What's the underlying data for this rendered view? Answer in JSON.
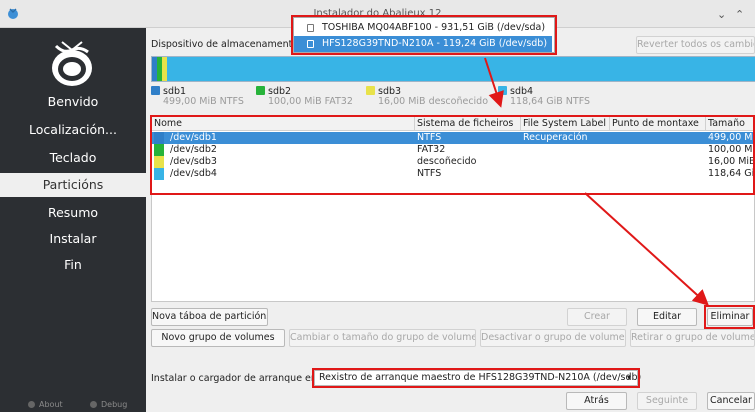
{
  "window": {
    "title": "Instalador do Abalieux 12",
    "minimize_icon": "chevron-down-icon",
    "maximize_icon": "chevron-up-icon"
  },
  "sidebar": {
    "items": [
      {
        "label": "Benvido"
      },
      {
        "label": "Localización..."
      },
      {
        "label": "Teclado"
      },
      {
        "label": "Particións"
      },
      {
        "label": "Resumo"
      },
      {
        "label": "Instalar"
      },
      {
        "label": "Fin"
      }
    ],
    "about": "About",
    "debug": "Debug"
  },
  "storage": {
    "label": "Dispositivo de almacenamento:",
    "revert_label": "Reverter todos os cambios",
    "options": [
      {
        "label": "TOSHIBA MQ04ABF100 - 931,51 GiB (/dev/sda)"
      },
      {
        "label": "HFS128G39TND-N210A - 119,24 GiB (/dev/sdb)"
      }
    ]
  },
  "diskbar": {
    "segments": [
      {
        "name": "sdb1",
        "color": "#2f7fc8",
        "fraction": 0.004
      },
      {
        "name": "sdb2",
        "color": "#27b33a",
        "fraction": 0.004
      },
      {
        "name": "sdb3",
        "color": "#e8e24a",
        "fraction": 0.003
      },
      {
        "name": "sdb4",
        "color": "#38b4e6",
        "fraction": 0.989
      }
    ]
  },
  "legend": [
    {
      "name": "sdb1",
      "color": "#2f7fc8",
      "detail": "499,00 MiB  NTFS"
    },
    {
      "name": "sdb2",
      "color": "#27b33a",
      "detail": "100,00 MiB  FAT32"
    },
    {
      "name": "sdb3",
      "color": "#e8e24a",
      "detail": "16,00 MiB  descoñecido"
    },
    {
      "name": "sdb4",
      "color": "#38b4e6",
      "detail": "118,64 GiB  NTFS"
    }
  ],
  "table": {
    "headers": [
      "Nome",
      "Sistema de ficheiros",
      "File System Label",
      "Punto de montaxe",
      "Tamaño"
    ],
    "rows": [
      {
        "color": "#2f7fc8",
        "name": "/dev/sdb1",
        "fs": "NTFS",
        "label": "Recuperación",
        "mount": "",
        "size": "499,00 MiB"
      },
      {
        "color": "#27b33a",
        "name": "/dev/sdb2",
        "fs": "FAT32",
        "label": "",
        "mount": "",
        "size": "100,00 MiB"
      },
      {
        "color": "#e8e24a",
        "name": "/dev/sdb3",
        "fs": "descoñecido",
        "label": "",
        "mount": "",
        "size": "16,00 MiB"
      },
      {
        "color": "#38b4e6",
        "name": "/dev/sdb4",
        "fs": "NTFS",
        "label": "",
        "mount": "",
        "size": "118,64 GiB"
      }
    ]
  },
  "buttons": {
    "new_table": "Nova táboa de particións",
    "create": "Crear",
    "edit": "Editar",
    "delete": "Eliminar",
    "new_group": "Novo grupo de volumes",
    "resize_group": "Cambiar o tamaño do grupo de volumes",
    "deactivate_group": "Desactivar o grupo de volumes",
    "remove_group": "Retirar o grupo de volumes"
  },
  "bootloader": {
    "label": "Instalar o cargador de arranque en:",
    "value": "Rexistro de arranque maestro de HFS128G39TND-N210A (/dev/sdb)"
  },
  "footer": {
    "back": "Atrás",
    "next": "Seguinte",
    "cancel": "Cancelar"
  }
}
